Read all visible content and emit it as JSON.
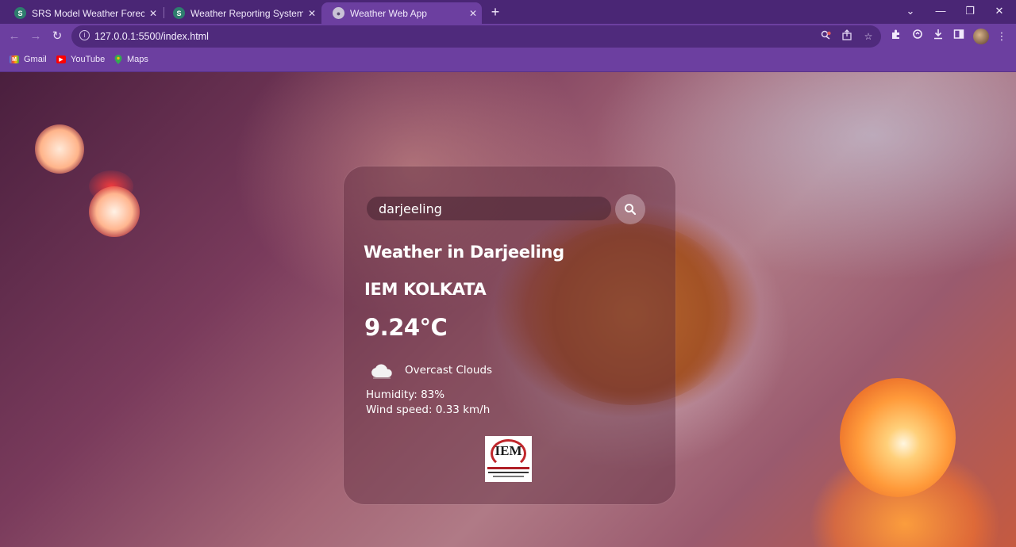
{
  "browser": {
    "tabs": [
      {
        "title": "SRS Model Weather Forecasting",
        "close": "✕",
        "favicon": "S",
        "active": false
      },
      {
        "title": "Weather Reporting System | PDF",
        "close": "✕",
        "favicon": "S",
        "active": false
      },
      {
        "title": "Weather Web App",
        "close": "✕",
        "favicon": "",
        "active": true
      }
    ],
    "new_tab": "+",
    "window_controls": {
      "dropdown": "⌄",
      "minimize": "—",
      "restore": "❐",
      "close": "✕"
    },
    "nav": {
      "back": "←",
      "forward": "→",
      "reload": "↻"
    },
    "url": "127.0.0.1:5500/index.html",
    "bookmarks": [
      {
        "label": "Gmail",
        "icon": "gmail-icon"
      },
      {
        "label": "YouTube",
        "icon": "youtube-icon"
      },
      {
        "label": "Maps",
        "icon": "maps-icon"
      }
    ]
  },
  "weather": {
    "search_value": "darjeeling",
    "city_heading": "Weather in Darjeeling",
    "org_name": "IEM KOLKATA",
    "temperature": "9.24°C",
    "description": "Overcast Clouds",
    "humidity": "Humidity: 83%",
    "wind": "Wind speed: 0.33 km/h",
    "logo_text": "IEM"
  },
  "colors": {
    "tabbar": "#4a2675",
    "toolbar": "#6c3fa0",
    "omnibox": "#4f2a7c"
  }
}
